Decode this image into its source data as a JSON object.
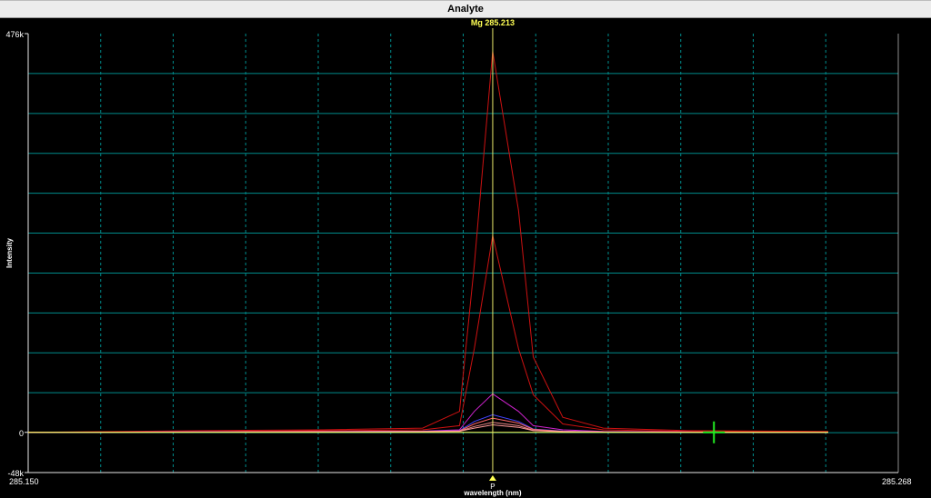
{
  "window": {
    "title": "Analyte"
  },
  "chart_data": {
    "type": "line",
    "title": "Mg 285.213",
    "xlabel": "wavelength (nm)",
    "ylabel": "Intensity",
    "xlim": [
      285.15,
      285.268
    ],
    "ylim": [
      -48000,
      476000
    ],
    "x_tick_labels": [
      "285.150",
      "285.268"
    ],
    "y_tick_labels": [
      {
        "label": "476k",
        "value": 476000
      },
      {
        "label": "0",
        "value": 0
      },
      {
        "label": "-48k",
        "value": -48000
      }
    ],
    "peak_marker": {
      "label": "P",
      "x": 285.213
    },
    "analyte_line": {
      "x": 285.213
    },
    "background_marker": {
      "x": 285.243,
      "y": 0
    },
    "grid": true,
    "x": [
      285.15,
      285.1735,
      285.19,
      285.2035,
      285.2085,
      285.2105,
      285.213,
      285.2165,
      285.2185,
      285.2225,
      285.228,
      285.2395,
      285.2585
    ],
    "series": [
      {
        "color": "#cc1111",
        "values": [
          0,
          2000,
          3000,
          5000,
          25000,
          200000,
          455000,
          265000,
          90000,
          18000,
          5000,
          2000,
          1000
        ]
      },
      {
        "color": "#cc1111",
        "values": [
          0,
          1000,
          2000,
          3000,
          8000,
          100000,
          235000,
          100000,
          45000,
          10000,
          3000,
          1000,
          500
        ]
      },
      {
        "color": "#cc22cc",
        "values": [
          0,
          500,
          1000,
          1500,
          3000,
          25000,
          46000,
          25000,
          8000,
          3000,
          1000,
          500,
          0
        ]
      },
      {
        "color": "#4444ff",
        "values": [
          0,
          500,
          800,
          1200,
          2000,
          13000,
          21000,
          13000,
          4000,
          1500,
          600,
          300,
          0
        ]
      },
      {
        "color": "#ff6666",
        "values": [
          0,
          400,
          700,
          1000,
          1800,
          10000,
          17000,
          11000,
          3500,
          1300,
          500,
          300,
          0
        ]
      },
      {
        "color": "#ee8888",
        "values": [
          0,
          300,
          600,
          900,
          1500,
          7000,
          12000,
          8000,
          2500,
          1000,
          400,
          200,
          0
        ]
      },
      {
        "color": "#ff9999",
        "values": [
          0,
          300,
          500,
          800,
          1300,
          5000,
          9000,
          6000,
          2000,
          800,
          300,
          200,
          0
        ]
      },
      {
        "color": "#ffff55",
        "values": [
          0,
          0,
          0,
          0,
          0,
          0,
          0,
          0,
          0,
          0,
          0,
          0,
          0
        ]
      }
    ],
    "colors": {
      "grid": "#008b8b",
      "axis": "#e8e8e8",
      "analyte_line": "#e8e86a",
      "title_text": "#ffff55",
      "background_marker": "#22ee22",
      "plot_background": "#000000"
    }
  }
}
